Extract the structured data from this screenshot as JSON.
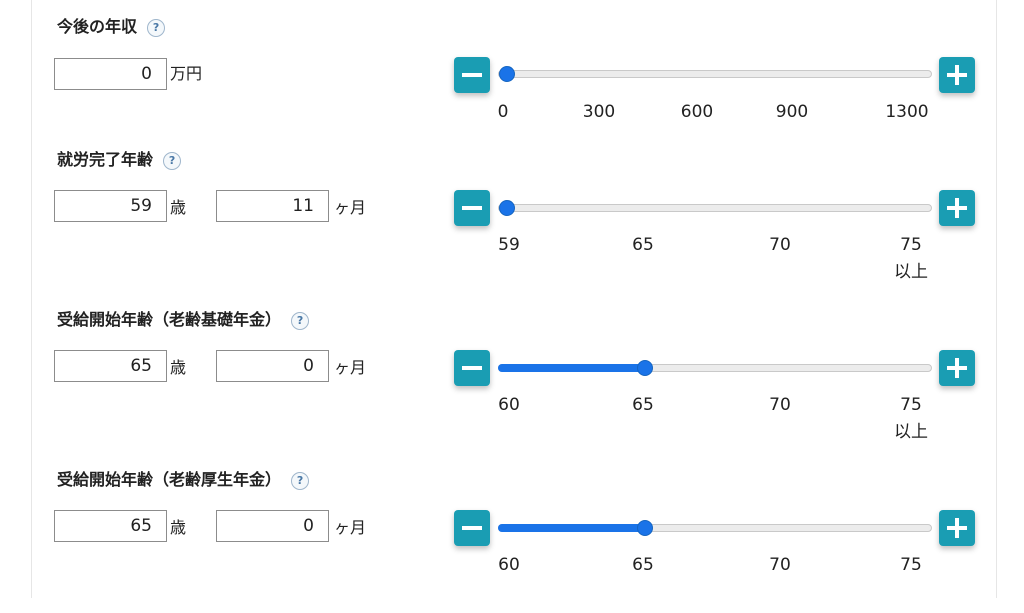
{
  "help_glyph": "?",
  "colors": {
    "button": "#1a9db3",
    "slider_fill": "#1a73e8",
    "track": "#ececec"
  },
  "icons": {
    "minus": "minus-icon",
    "plus": "plus-icon",
    "help": "question-icon"
  },
  "future_income": {
    "title": "今後の年収",
    "value": "0",
    "unit": "万円",
    "slider_value": "0",
    "ticks": [
      "0",
      "300",
      "600",
      "900",
      "1300"
    ]
  },
  "work_end_age": {
    "title": "就労完了年齢",
    "years": "59",
    "years_unit": "歳",
    "months": "11",
    "months_unit": "ヶ月",
    "slider_value": "59",
    "ticks": [
      "59",
      "65",
      "70",
      "75"
    ],
    "last_tick_suffix": "以上"
  },
  "basic_pension_start": {
    "title": "受給開始年齢（老齢基礎年金）",
    "years": "65",
    "years_unit": "歳",
    "months": "0",
    "months_unit": "ヶ月",
    "slider_value": "65",
    "ticks": [
      "60",
      "65",
      "70",
      "75"
    ],
    "last_tick_suffix": "以上"
  },
  "employee_pension_start": {
    "title": "受給開始年齢（老齢厚生年金）",
    "years": "65",
    "years_unit": "歳",
    "months": "0",
    "months_unit": "ヶ月",
    "slider_value": "65",
    "ticks": [
      "60",
      "65",
      "70",
      "75"
    ]
  }
}
